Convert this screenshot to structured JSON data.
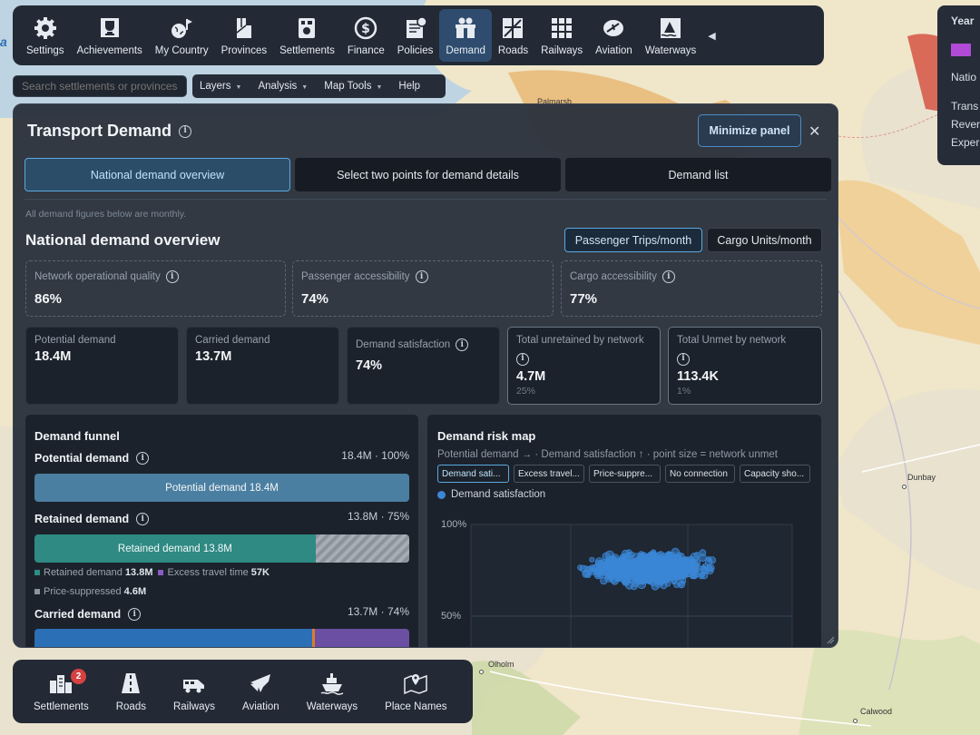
{
  "map": {
    "places": [
      "Palmarsh",
      "Dunbay",
      "Olholm",
      "Calwood"
    ],
    "logo_fragment": "a"
  },
  "toolbar": {
    "items": [
      {
        "label": "Settings",
        "icon": "gear-icon"
      },
      {
        "label": "Achievements",
        "icon": "trophy-icon"
      },
      {
        "label": "My Country",
        "icon": "globe-icon"
      },
      {
        "label": "Provinces",
        "icon": "provinces-icon"
      },
      {
        "label": "Settlements",
        "icon": "settlements-icon"
      },
      {
        "label": "Finance",
        "icon": "dollar-icon"
      },
      {
        "label": "Policies",
        "icon": "policies-icon"
      },
      {
        "label": "Demand",
        "icon": "demand-icon"
      },
      {
        "label": "Roads",
        "icon": "road-icon"
      },
      {
        "label": "Railways",
        "icon": "railway-icon"
      },
      {
        "label": "Aviation",
        "icon": "aviation-icon"
      },
      {
        "label": "Waterways",
        "icon": "waterway-icon"
      }
    ],
    "active": "Demand",
    "collapse_glyph": "◀"
  },
  "search": {
    "placeholder": "Search settlements or provinces"
  },
  "menubar": {
    "items": [
      "Layers",
      "Analysis",
      "Map Tools",
      "Help"
    ]
  },
  "right_panel": {
    "year_label": "Year",
    "rows": [
      "Natio",
      "Trans",
      "Rever",
      "Exper"
    ]
  },
  "panel": {
    "title": "Transport Demand",
    "minimize_label": "Minimize panel",
    "close_glyph": "✕",
    "tabs": [
      "National demand overview",
      "Select two points for demand details",
      "Demand list"
    ],
    "note": "All demand figures below are monthly.",
    "section_title": "National demand overview",
    "unit_toggle": [
      "Passenger Trips/month",
      "Cargo Units/month"
    ],
    "quality_cards": [
      {
        "label": "Network operational quality",
        "value": "86%"
      },
      {
        "label": "Passenger accessibility",
        "value": "74%"
      },
      {
        "label": "Cargo accessibility",
        "value": "77%"
      }
    ],
    "metric_cards": [
      {
        "label": "Potential demand",
        "value": "18.4M",
        "sub": ""
      },
      {
        "label": "Carried demand",
        "value": "13.7M",
        "sub": ""
      },
      {
        "label": "Demand satisfaction",
        "value": "74%",
        "sub": ""
      },
      {
        "label": "Total unretained by network",
        "value": "4.7M",
        "sub": "25%"
      },
      {
        "label": "Total Unmet by network",
        "value": "113.4K",
        "sub": "1%"
      }
    ],
    "funnel": {
      "title": "Demand funnel",
      "stages": [
        {
          "label": "Potential demand",
          "right": "18.4M · 100%",
          "bar_label": "Potential demand 18.4M",
          "share": 1.0
        },
        {
          "label": "Retained demand",
          "right": "13.8M · 75%",
          "bar_label": "Retained demand 13.8M",
          "share": 0.75
        },
        {
          "label": "Carried demand",
          "right": "13.7M · 74%",
          "bar_label": "",
          "share": 0.74
        }
      ],
      "legend1": {
        "retained_label": "Retained demand",
        "retained_value": "13.8M",
        "excess_label": "Excess travel time",
        "excess_value": "57K"
      },
      "legend2": {
        "price_label": "Price-suppressed",
        "price_value": "4.6M"
      },
      "colors": {
        "potential": "#4a7fa1",
        "retained": "#2e8a83",
        "carried": "#2b6fb6",
        "excess": "#8a5cc7",
        "price": "#8d939b"
      }
    },
    "risk_map": {
      "title": "Demand risk map",
      "description": "Potential demand → · Demand satisfaction ↑ · point size = network unmet",
      "chips": [
        "Demand sati...",
        "Excess travel...",
        "Price-suppre...",
        "No connection",
        "Capacity sho..."
      ],
      "series_label": "Demand satisfaction",
      "y_ticks": [
        "100%",
        "50%"
      ],
      "point_color": "#3b86d6"
    }
  },
  "bottombar": {
    "items": [
      {
        "label": "Settlements",
        "icon": "settlements-build-icon",
        "badge": "2"
      },
      {
        "label": "Roads",
        "icon": "road-build-icon"
      },
      {
        "label": "Railways",
        "icon": "train-build-icon"
      },
      {
        "label": "Aviation",
        "icon": "airplane-build-icon"
      },
      {
        "label": "Waterways",
        "icon": "ship-build-icon"
      },
      {
        "label": "Place Names",
        "icon": "map-pin-icon"
      }
    ]
  }
}
